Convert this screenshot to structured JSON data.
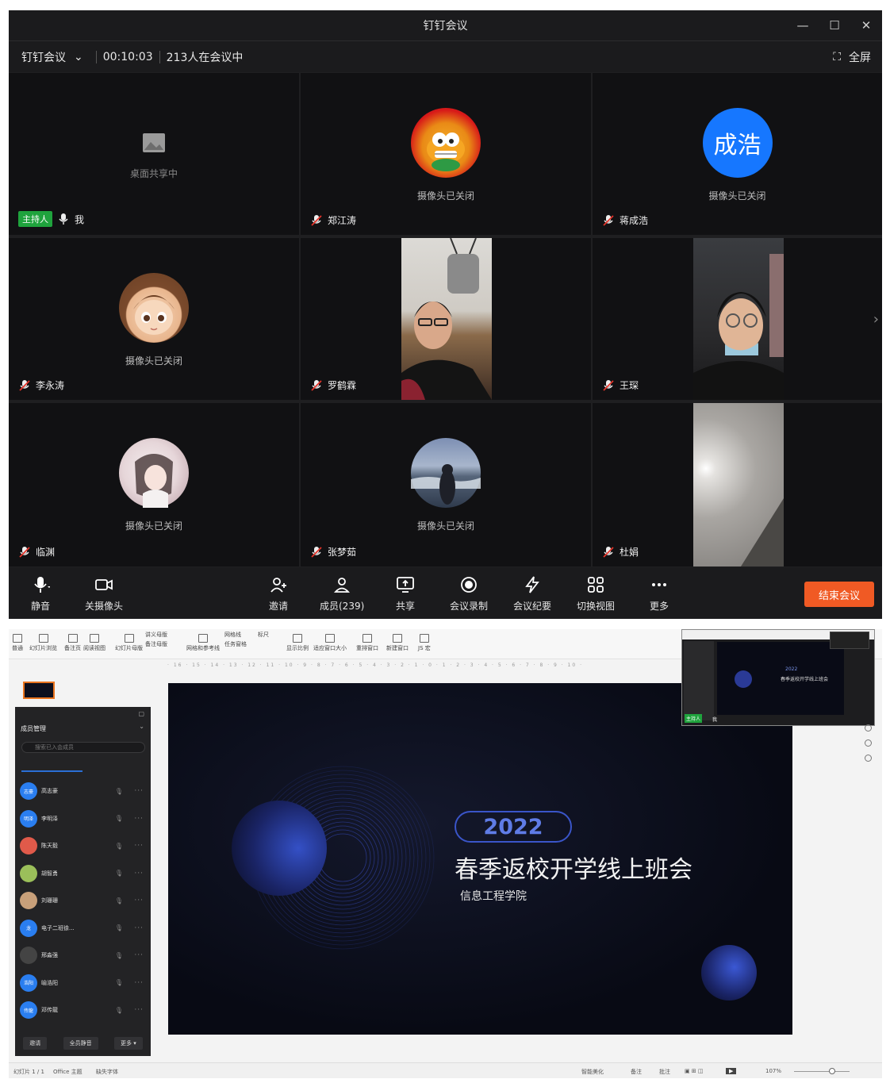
{
  "window": {
    "title": "钉钉会议"
  },
  "subbar": {
    "app_label": "钉钉会议",
    "timer": "00:10:03",
    "count": "213人在会议中",
    "fullscreen": "全屏"
  },
  "tiles": [
    {
      "name": "我",
      "status": "桌面共享中",
      "host_badge": "主持人"
    },
    {
      "name": "郑江涛",
      "status": "摄像头已关闭"
    },
    {
      "name": "蒋成浩",
      "status": "摄像头已关闭",
      "avatar_text": "成浩",
      "avatar_color": "#1677ff"
    },
    {
      "name": "李永涛",
      "status": "摄像头已关闭"
    },
    {
      "name": "罗鹤霖"
    },
    {
      "name": "王琛"
    },
    {
      "name": "临渊",
      "status": "摄像头已关闭"
    },
    {
      "name": "张梦茹",
      "status": "摄像头已关闭"
    },
    {
      "name": "杜娟"
    }
  ],
  "toolbar": {
    "mute": "静音",
    "camera": "关摄像头",
    "invite": "邀请",
    "members": "成员(239)",
    "share": "共享",
    "record": "会议录制",
    "minutes": "会议纪要",
    "switch_view": "切换视图",
    "more": "更多",
    "end": "结束会议",
    "end_color": "#f05a24"
  },
  "ppt": {
    "ribbon": [
      "普通",
      "幻灯片浏览",
      "备注页",
      "阅读视图",
      "幻灯片母版",
      "讲义母版",
      "备注母版",
      "网格和参考线",
      "网格线",
      "标尺",
      "任务窗格",
      "显示比例",
      "适应窗口大小",
      "重排窗口",
      "新建窗口",
      "JS 宏"
    ],
    "ruler": "· 16 · 15 · 14 · 13 · 12 · 11 · 10 · 9 · 8 · 7 · 6 · 5 · 4 · 3 · 2 · 1 · 0 · 1 · 2 · 3 · 4 · 5 · 6 · 7 · 8 · 9 · 10 ·",
    "member_panel": {
      "title": "成员管理",
      "search_placeholder": "搜索已入会成员",
      "members": [
        {
          "avatar": "志豪",
          "name": "高志豪"
        },
        {
          "avatar": "明泽",
          "name": "李明泽"
        },
        {
          "avatar": "",
          "name": "陈天毅"
        },
        {
          "avatar": "",
          "name": "胡智勇"
        },
        {
          "avatar": "",
          "name": "刘珊珊"
        },
        {
          "avatar": "龙",
          "name": "电子二班徐..."
        },
        {
          "avatar": "",
          "name": "邢淼强"
        },
        {
          "avatar": "浩阳",
          "name": "喻浩阳"
        },
        {
          "avatar": "传龍",
          "name": "邓传龍"
        }
      ],
      "footer": [
        "邀请",
        "全员静音",
        "更多 ▾"
      ]
    },
    "slide": {
      "year": "2022",
      "title": "春季返校开学线上班会",
      "subtitle": "信息工程学院"
    },
    "mini": {
      "host": "主持人",
      "me": "我",
      "year": "2022",
      "title": "春季返校开学线上班会"
    },
    "status": {
      "slide_no": "幻灯片 1 / 1",
      "theme": "Office 主题",
      "font": "缺失字体",
      "beautify": "智能美化",
      "notes": "备注",
      "comment": "批注",
      "zoom": "107%"
    }
  }
}
